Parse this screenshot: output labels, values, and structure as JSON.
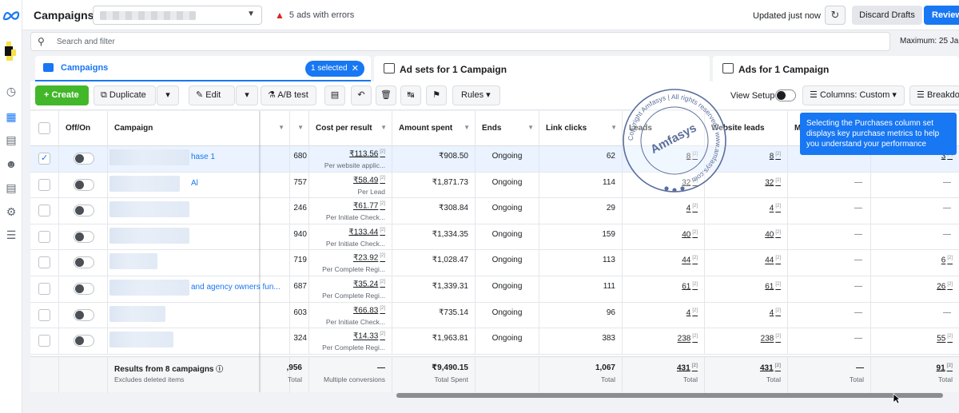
{
  "app": {
    "title": "Campaigns",
    "errors_text": "5 ads with errors",
    "updated_text": "Updated just now",
    "discard_label": "Discard Drafts",
    "review_label": "Review"
  },
  "search": {
    "placeholder": "Search and filter",
    "maximum_text": "Maximum: 25 Ja"
  },
  "tabs": {
    "campaigns": "Campaigns",
    "selected_pill": "1 selected",
    "adsets": "Ad sets for 1 Campaign",
    "ads": "Ads for 1 Campaign"
  },
  "toolbar": {
    "create": "Create",
    "duplicate": "Duplicate",
    "edit": "Edit",
    "ab_test": "A/B test",
    "rules": "Rules",
    "view_setup": "View Setup",
    "columns": "Columns: Custom",
    "breakdown": "Breakdo"
  },
  "tooltip": "Selecting the Purchases column set displays key purchase metrics to help you understand your performance",
  "columns": {
    "off_on": "Off/On",
    "campaign": "Campaign",
    "cost_per_result": "Cost per result",
    "amount_spent": "Amount spent",
    "ends": "Ends",
    "link_clicks": "Link clicks",
    "leads": "Leads",
    "website_leads": "Website leads",
    "m": "M"
  },
  "rows": [
    {
      "name": "hase 1",
      "results": "680",
      "cpr": "₹113.56",
      "cpr_sub": "Per website applic...",
      "spent": "₹908.50",
      "ends": "Ongoing",
      "clicks": "62",
      "leads": "8",
      "wleads": "8",
      "m": "",
      "last": "3",
      "selected": true
    },
    {
      "name": "Al",
      "results": "757",
      "cpr": "₹58.49",
      "cpr_sub": "Per Lead",
      "spent": "₹1,871.73",
      "ends": "Ongoing",
      "clicks": "114",
      "leads": "32",
      "wleads": "32",
      "m": "—",
      "last": "—",
      "selected": false
    },
    {
      "name": "",
      "results": "246",
      "cpr": "₹61.77",
      "cpr_sub": "Per Initiate Check...",
      "spent": "₹308.84",
      "ends": "Ongoing",
      "clicks": "29",
      "leads": "4",
      "wleads": "4",
      "m": "—",
      "last": "—",
      "selected": false
    },
    {
      "name": "",
      "results": "940",
      "cpr": "₹133.44",
      "cpr_sub": "Per Initiate Check...",
      "spent": "₹1,334.35",
      "ends": "Ongoing",
      "clicks": "159",
      "leads": "40",
      "wleads": "40",
      "m": "—",
      "last": "—",
      "selected": false
    },
    {
      "name": "",
      "results": "719",
      "cpr": "₹23.92",
      "cpr_sub": "Per Complete Regi...",
      "spent": "₹1,028.47",
      "ends": "Ongoing",
      "clicks": "113",
      "leads": "44",
      "wleads": "44",
      "m": "—",
      "last": "6",
      "selected": false
    },
    {
      "name": "and agency owners fun...",
      "results": "687",
      "cpr": "₹35.24",
      "cpr_sub": "Per Complete Regi...",
      "spent": "₹1,339.31",
      "ends": "Ongoing",
      "clicks": "111",
      "leads": "61",
      "wleads": "61",
      "m": "—",
      "last": "26",
      "selected": false
    },
    {
      "name": "",
      "results": "603",
      "cpr": "₹66.83",
      "cpr_sub": "Per Initiate Check...",
      "spent": "₹735.14",
      "ends": "Ongoing",
      "clicks": "96",
      "leads": "4",
      "wleads": "4",
      "m": "—",
      "last": "—",
      "selected": false
    },
    {
      "name": "",
      "results": "324",
      "cpr": "₹14.33",
      "cpr_sub": "Per Complete Regi...",
      "spent": "₹1,963.81",
      "ends": "Ongoing",
      "clicks": "383",
      "leads": "238",
      "wleads": "238",
      "m": "—",
      "last": "55",
      "selected": false
    }
  ],
  "footer": {
    "results_label": "Results from 8 campaigns",
    "excludes": "Excludes deleted items",
    "results": ",956",
    "results_sub": "Total",
    "cpr": "—",
    "cpr_sub": "Multiple conversions",
    "spent": "₹9,490.15",
    "spent_sub": "Total Spent",
    "clicks": "1,067",
    "clicks_sub": "Total",
    "leads": "431",
    "leads_sub": "Total",
    "wleads": "431",
    "wleads_sub": "Total",
    "m": "—",
    "m_sub": "Total",
    "last": "91",
    "last_sub": "Total"
  },
  "watermark": {
    "top_text": "Copyright Amfasys | All rights reserved | www.amfasys.com",
    "brand": "Amfasys"
  },
  "colors": {
    "accent": "#1877f2",
    "create_green": "#42b72a",
    "error_red": "#e02020"
  }
}
